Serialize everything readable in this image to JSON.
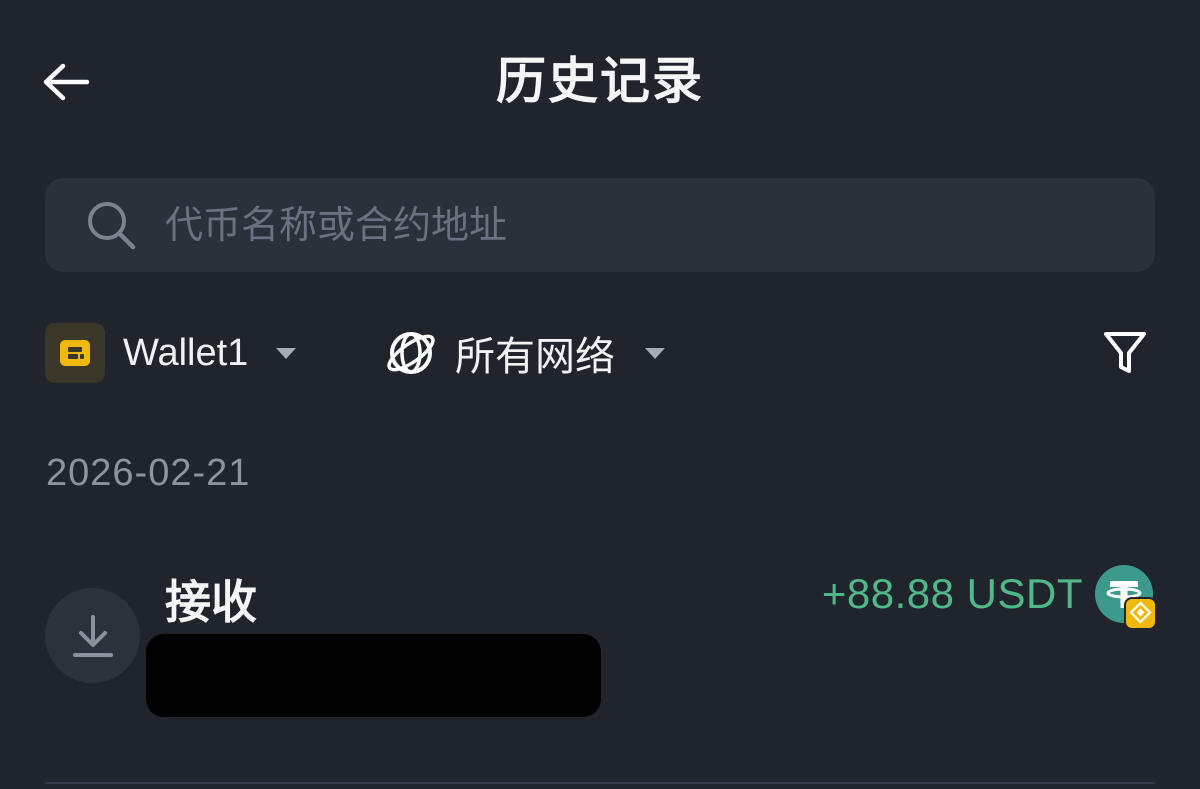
{
  "header": {
    "title": "历史记录",
    "back_icon": "arrow-left-icon"
  },
  "search": {
    "placeholder": "代币名称或合约地址",
    "value": "",
    "icon": "search-icon"
  },
  "filters": {
    "wallet": {
      "label": "Wallet1",
      "icon": "wallet-icon",
      "accent_color": "#f0b90b"
    },
    "network": {
      "label": "所有网络",
      "icon": "globe-icon"
    },
    "filter_icon": "filter-funnel-icon"
  },
  "transactions": {
    "date": "2026-02-21",
    "items": [
      {
        "type_label": "接收",
        "type_icon": "download-icon",
        "amount": "+88.88 USDT",
        "amount_color": "#4fb98a",
        "token_icon": "usdt-icon",
        "network_badge_icon": "bnb-chain-icon"
      }
    ]
  },
  "colors": {
    "background": "#20242c",
    "search_background": "#2b303b",
    "positive": "#4fb98a",
    "muted_text": "#8e939d"
  }
}
